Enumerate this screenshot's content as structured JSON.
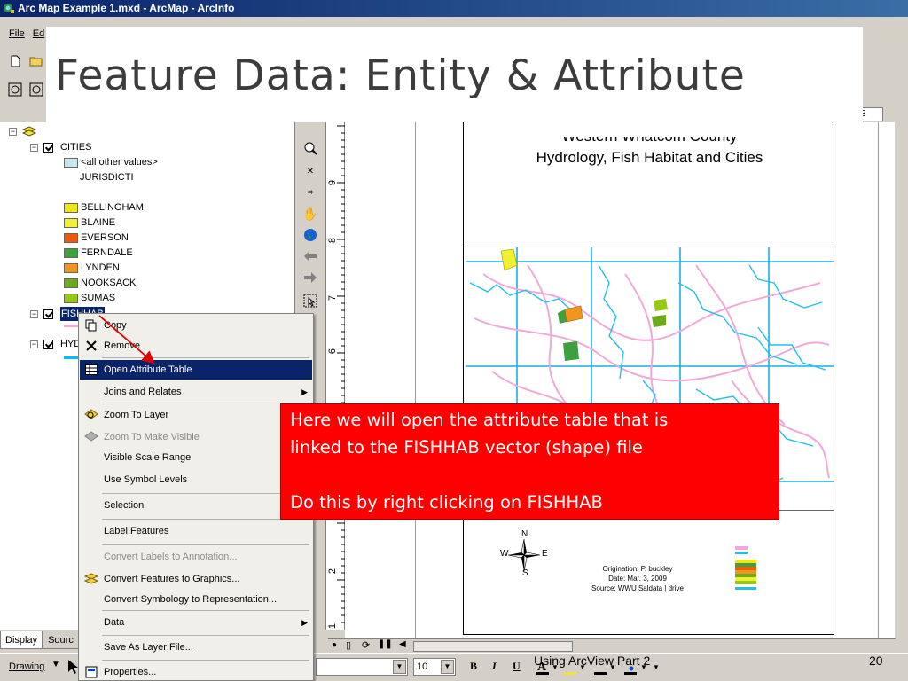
{
  "window": {
    "title": "Arc Map Example 1.mxd - ArcMap - ArcInfo"
  },
  "menubar": {
    "items": [
      "File",
      "Ed"
    ]
  },
  "slide": {
    "title": "Feature Data: Entity & Attribute",
    "footer": "Using ArcView Part 2",
    "page_number": "20"
  },
  "toc": {
    "layers": [
      {
        "name": "CITIES",
        "field": "JURISDICTI",
        "other_label": "<all other values>"
      }
    ],
    "legend": [
      {
        "label": "BELLINGHAM",
        "color": "#f2e313"
      },
      {
        "label": "BLAINE",
        "color": "#f0f030"
      },
      {
        "label": "EVERSON",
        "color": "#f05a0a"
      },
      {
        "label": "FERNDALE",
        "color": "#3ca03c"
      },
      {
        "label": "LYNDEN",
        "color": "#f0961e"
      },
      {
        "label": "NOOKSACK",
        "color": "#6eaa1e"
      },
      {
        "label": "SUMAS",
        "color": "#96c814"
      }
    ],
    "selected_layer": "FISHHAB",
    "third_layer": "HYD",
    "tabs": [
      "Display",
      "Sourc"
    ]
  },
  "context_menu": {
    "items": [
      {
        "label": "Copy",
        "icon": "copy-icon",
        "enabled": true
      },
      {
        "label": "Remove",
        "icon": "remove-icon",
        "enabled": true
      },
      {
        "label": "Open Attribute Table",
        "icon": "table-icon",
        "enabled": true,
        "selected": true
      },
      {
        "label": "Joins and Relates",
        "icon": "",
        "enabled": true,
        "submenu": true
      },
      {
        "label": "Zoom To Layer",
        "icon": "zoom-to-layer-icon",
        "enabled": true
      },
      {
        "label": "Zoom To Make Visible",
        "icon": "zoom-visible-icon",
        "enabled": false
      },
      {
        "label": "Visible Scale Range",
        "icon": "",
        "enabled": true
      },
      {
        "label": "Use Symbol Levels",
        "icon": "",
        "enabled": true
      },
      {
        "label": "Selection",
        "icon": "",
        "enabled": true
      },
      {
        "label": "Label Features",
        "icon": "",
        "enabled": true
      },
      {
        "label": "Convert Labels to Annotation...",
        "icon": "",
        "enabled": false
      },
      {
        "label": "Convert Features to Graphics...",
        "icon": "convert-graphics-icon",
        "enabled": true
      },
      {
        "label": "Convert Symbology to Representation...",
        "icon": "",
        "enabled": true
      },
      {
        "label": "Data",
        "icon": "",
        "enabled": true,
        "submenu": true
      },
      {
        "label": "Save As Layer File...",
        "icon": "",
        "enabled": true
      },
      {
        "label": "Properties...",
        "icon": "properties-icon",
        "enabled": true
      }
    ]
  },
  "callout": {
    "lines": [
      "Here we will open the attribute table that is",
      "linked to the FISHHAB vector (shape) file",
      "",
      "Do this by right clicking on FISHHAB"
    ],
    "color": "#ff0000"
  },
  "map_layout": {
    "title_line1": "Western Whatcom County",
    "title_line2": "Hydrology, Fish Habitat and Cities",
    "credits": [
      "Origination: P. buckley",
      "Date: Mar. 3, 2009",
      "Source: WWU Saldata | drive"
    ],
    "north_labels": {
      "n": "N",
      "s": "S",
      "e": "E",
      "w": "W"
    }
  },
  "ruler": {
    "labels": [
      "9",
      "8",
      "7",
      "6",
      "2",
      "1"
    ]
  },
  "drawing_toolbar": {
    "label": "Drawing",
    "font_size": "10",
    "bold": "B",
    "italic": "I",
    "underline": "U"
  },
  "scale_box": "3"
}
